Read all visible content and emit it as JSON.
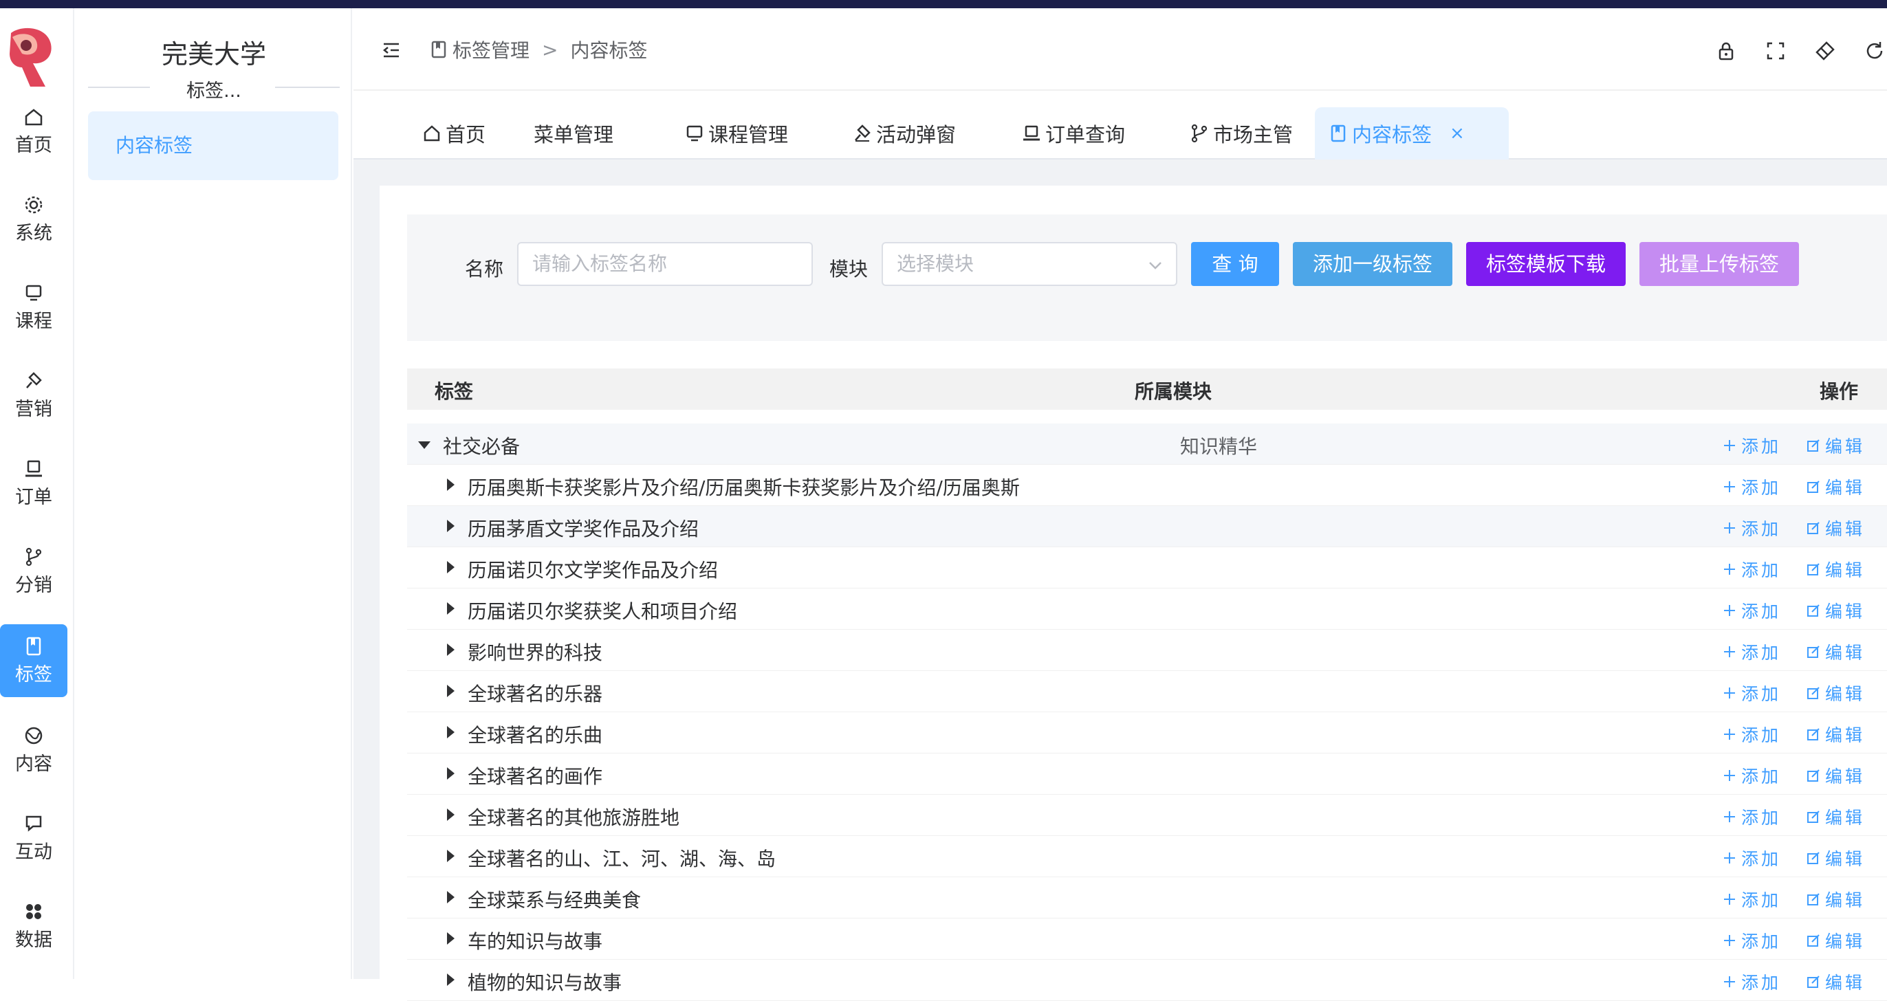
{
  "rail": {
    "items": [
      {
        "label": "首页",
        "icon": "home-icon"
      },
      {
        "label": "系统",
        "icon": "gear-icon"
      },
      {
        "label": "课程",
        "icon": "monitor-icon"
      },
      {
        "label": "营销",
        "icon": "hammer-icon"
      },
      {
        "label": "订单",
        "icon": "laptop-icon"
      },
      {
        "label": "分销",
        "icon": "branch-icon"
      },
      {
        "label": "标签",
        "icon": "bookmark-icon",
        "active": true
      },
      {
        "label": "内容",
        "icon": "globe-icon"
      },
      {
        "label": "互动",
        "icon": "chat-icon"
      },
      {
        "label": "数据",
        "icon": "grid-icon"
      }
    ]
  },
  "subside": {
    "school": "完美大学",
    "section": "标签...",
    "items": [
      {
        "label": "内容标签"
      }
    ]
  },
  "header": {
    "breadcrumb": [
      "标签管理",
      "内容标签"
    ],
    "breadcrumb_sep": ">"
  },
  "tabs": [
    {
      "label": "首页",
      "icon": "home-icon"
    },
    {
      "label": "菜单管理",
      "icon": ""
    },
    {
      "label": "课程管理",
      "icon": "monitor-icon"
    },
    {
      "label": "活动弹窗",
      "icon": "hammer-icon"
    },
    {
      "label": "订单查询",
      "icon": "laptop-icon"
    },
    {
      "label": "市场主管",
      "icon": "branch-icon"
    },
    {
      "label": "内容标签",
      "icon": "bookmark-icon",
      "active": true,
      "close": "×"
    }
  ],
  "filter": {
    "name_label": "名称",
    "name_placeholder": "请输入标签名称",
    "module_label": "模块",
    "module_placeholder": "选择模块",
    "buttons": {
      "query": "查 询",
      "add_top": "添加一级标签",
      "download": "标签模板下载",
      "upload": "批量上传标签"
    }
  },
  "table": {
    "columns": [
      "标签",
      "所属模块",
      "操作"
    ],
    "action_add": "添加",
    "action_edit": "编辑",
    "rows": [
      {
        "label": "社交必备",
        "module": "知识精华",
        "level": 0,
        "expanded": true
      },
      {
        "label": "历届奥斯卡获奖影片及介绍/历届奥斯卡获奖影片及介绍/历届奥斯",
        "module": "",
        "level": 1
      },
      {
        "label": "历届茅盾文学奖作品及介绍",
        "module": "",
        "level": 1
      },
      {
        "label": "历届诺贝尔文学奖作品及介绍",
        "module": "",
        "level": 1
      },
      {
        "label": "历届诺贝尔奖获奖人和项目介绍",
        "module": "",
        "level": 1
      },
      {
        "label": "影响世界的科技",
        "module": "",
        "level": 1
      },
      {
        "label": "全球著名的乐器",
        "module": "",
        "level": 1
      },
      {
        "label": "全球著名的乐曲",
        "module": "",
        "level": 1
      },
      {
        "label": "全球著名的画作",
        "module": "",
        "level": 1
      },
      {
        "label": "全球著名的其他旅游胜地",
        "module": "",
        "level": 1
      },
      {
        "label": "全球著名的山、江、河、湖、海、岛",
        "module": "",
        "level": 1
      },
      {
        "label": "全球菜系与经典美食",
        "module": "",
        "level": 1
      },
      {
        "label": "车的知识与故事",
        "module": "",
        "level": 1
      },
      {
        "label": "植物的知识与故事",
        "module": "",
        "level": 1
      }
    ]
  },
  "colors": {
    "primary": "#409eff",
    "add_btn": "#4da6e8",
    "download_btn": "#7e1cf0",
    "upload_btn": "#c58cf2"
  }
}
